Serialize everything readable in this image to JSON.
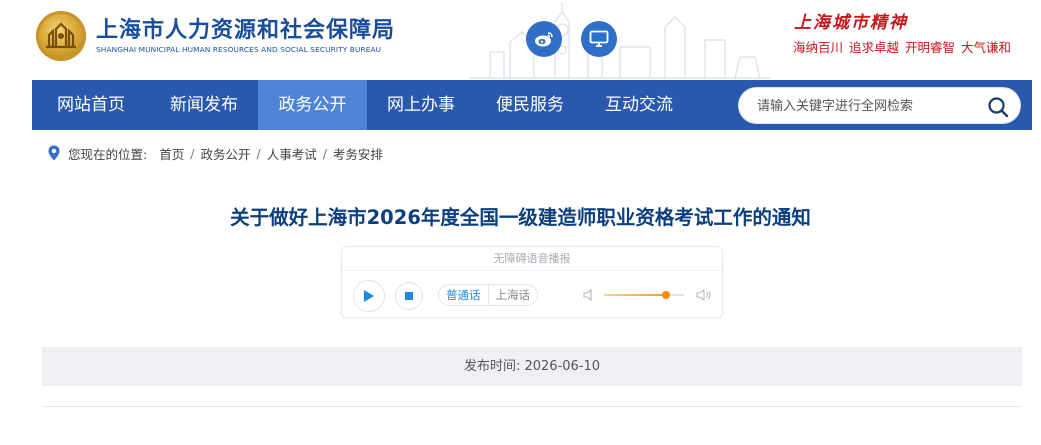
{
  "header": {
    "site_title": "上海市人力资源和社会保障局",
    "site_subtitle": "SHANGHAI MUNICIPAL HUMAN RESOURCES AND SOCIAL SECURITY BUREAU",
    "social": [
      "weibo-icon",
      "tv-icon"
    ],
    "spirit": {
      "title": "上海城市精神",
      "words": [
        "海纳百川",
        "追求卓越",
        "开明睿智",
        "大气谦和"
      ]
    }
  },
  "nav": {
    "items": [
      {
        "label": "网站首页",
        "active": false
      },
      {
        "label": "新闻发布",
        "active": false
      },
      {
        "label": "政务公开",
        "active": true
      },
      {
        "label": "网上办事",
        "active": false
      },
      {
        "label": "便民服务",
        "active": false
      },
      {
        "label": "互动交流",
        "active": false
      }
    ],
    "search": {
      "value": "",
      "placeholder": "请输入关键字进行全网检索",
      "icon": "search-icon"
    }
  },
  "breadcrumb": {
    "prefix": "您现在的位置:",
    "items": [
      "首页",
      "政务公开",
      "人事考试",
      "考务安排"
    ],
    "separator": "/"
  },
  "article": {
    "title": "关于做好上海市2026年度全国一级建造师职业资格考试工作的通知",
    "player": {
      "label": "无障碍语音播报",
      "languages": [
        "普通话",
        "上海话"
      ],
      "selected_language": "普通话",
      "volume": 0.78
    },
    "publish": {
      "label": "发布时间:",
      "date": "2026-06-10"
    }
  },
  "colors": {
    "nav_bg": "#2a58ad",
    "nav_active": "#4e83d6",
    "title_blue": "#0d3f7f",
    "brand_red": "#c8161d",
    "volume_orange": "#f58a0b"
  }
}
